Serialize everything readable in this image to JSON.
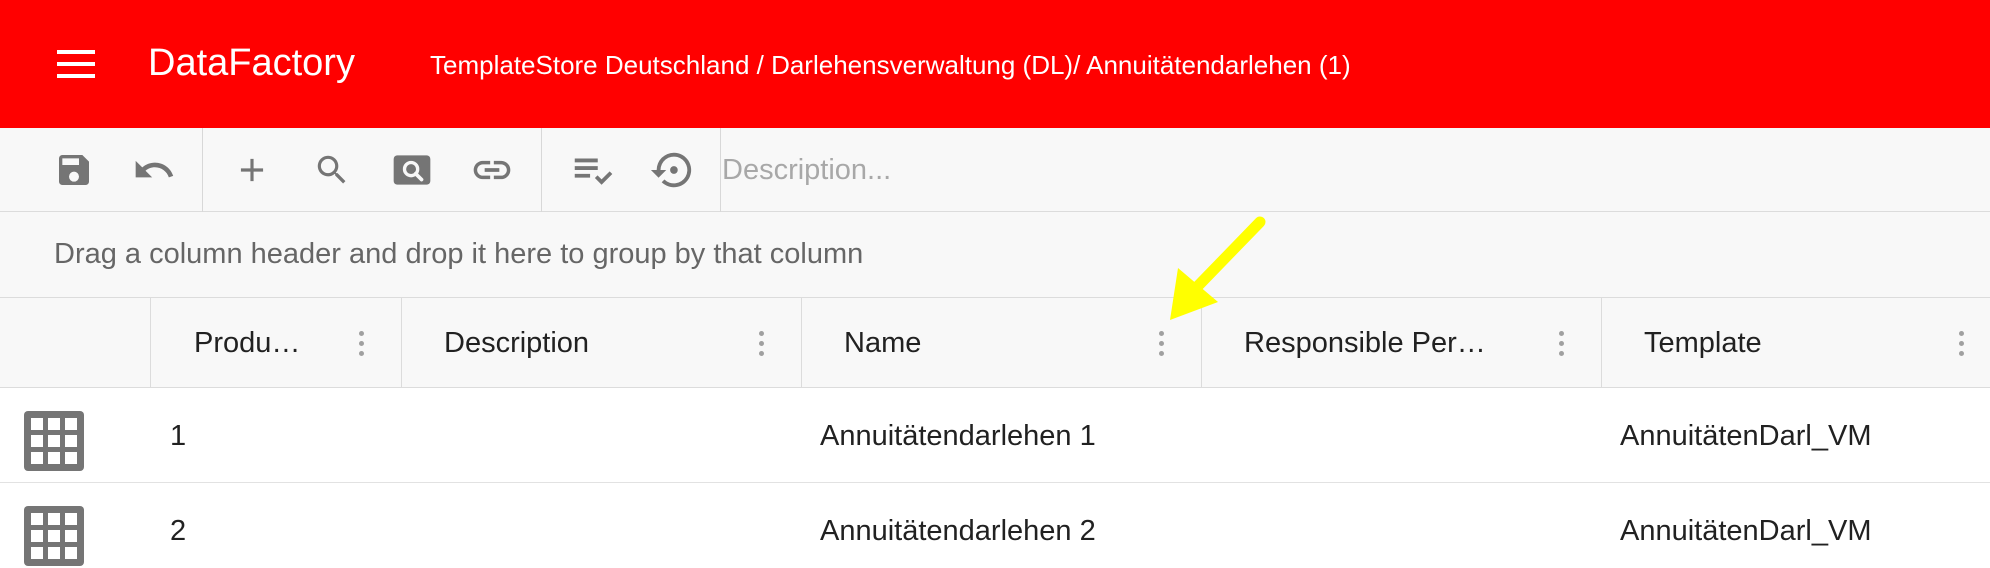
{
  "header": {
    "title": "DataFactory",
    "breadcrumb": "TemplateStore Deutschland / Darlehensverwaltung (DL)/ Annuitätendarlehen (1)"
  },
  "colors": {
    "accent": "#ff0000",
    "toolbar_bg": "#f8f8f8",
    "icon": "#757575",
    "annotation_arrow": "#ffff00"
  },
  "toolbar": {
    "buttons": [
      "save-icon",
      "undo-icon",
      "add-icon",
      "search-icon",
      "search-box-icon",
      "link-icon",
      "checklist-icon",
      "restore-icon"
    ],
    "description": {
      "value": "",
      "placeholder": "Description..."
    }
  },
  "grid": {
    "group_hint": "Drag a column header and drop it here to group by that column",
    "columns": [
      "Produ…",
      "Description",
      "Name",
      "Responsible Per…",
      "Template"
    ],
    "rows": [
      {
        "produ": "1",
        "description": "",
        "name": "Annuitätendarlehen 1",
        "responsible": "",
        "template": "AnnuitätenDarl_VM"
      },
      {
        "produ": "2",
        "description": "",
        "name": "Annuitätendarlehen 2",
        "responsible": "",
        "template": "AnnuitätenDarl_VM"
      }
    ]
  }
}
